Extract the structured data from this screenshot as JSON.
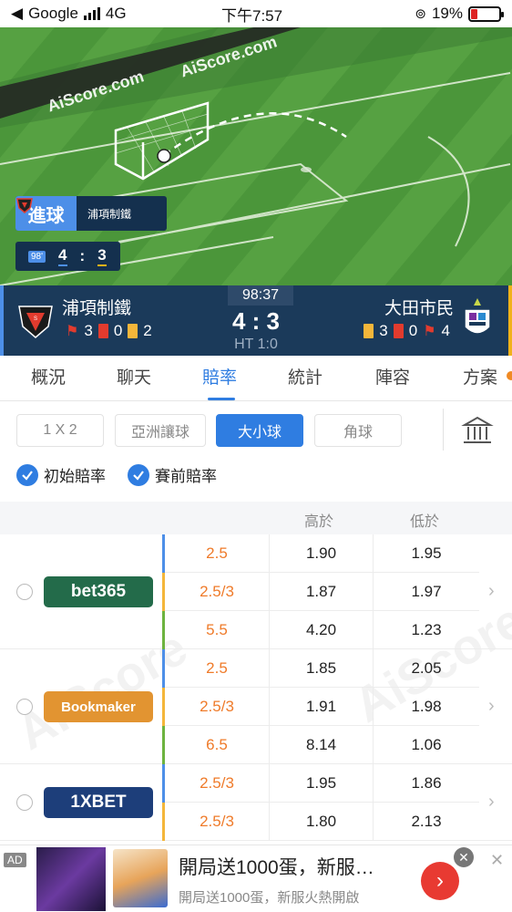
{
  "status_bar": {
    "back_app": "Google",
    "network": "4G",
    "time": "下午7:57",
    "battery": "19%"
  },
  "field": {
    "watermark": "AiScore.com",
    "goal_card": {
      "tag": "進球",
      "team": "浦項制鐵"
    },
    "mini_score": {
      "minute": "98'",
      "home": "4",
      "sep": ":",
      "away": "3"
    }
  },
  "match": {
    "timer": "98:37",
    "score": "4 : 3",
    "half_time": "HT 1:0",
    "home": {
      "name": "浦項制鐵",
      "corners": "3",
      "red": "0",
      "yellow": "2"
    },
    "away": {
      "name": "大田市民",
      "yellow": "3",
      "red": "0",
      "corners": "4"
    }
  },
  "tabs": [
    "概況",
    "聊天",
    "賠率",
    "統計",
    "陣容",
    "方案"
  ],
  "active_tab": "賠率",
  "filters": {
    "buttons": [
      "1 X 2",
      "亞洲讓球",
      "大小球",
      "角球"
    ],
    "active": "大小球",
    "checks": [
      "初始賠率",
      "賽前賠率"
    ]
  },
  "table_head": {
    "over": "高於",
    "under": "低於"
  },
  "bookmakers": [
    {
      "name": "bet365",
      "color": "#236b4a",
      "rows": [
        {
          "line": "2.5",
          "over": "1.90",
          "under": "1.95",
          "bar": "#4d8fe8"
        },
        {
          "line": "2.5/3",
          "over": "1.87",
          "under": "1.97",
          "bar": "#f4b63a"
        },
        {
          "line": "5.5",
          "over": "4.20",
          "under": "1.23",
          "bar": "#6db33f"
        }
      ]
    },
    {
      "name": "Bookmaker",
      "color": "#e29431",
      "rows": [
        {
          "line": "2.5",
          "over": "1.85",
          "under": "2.05",
          "bar": "#4d8fe8"
        },
        {
          "line": "2.5/3",
          "over": "1.91",
          "under": "1.98",
          "bar": "#f4b63a"
        },
        {
          "line": "6.5",
          "over": "8.14",
          "under": "1.06",
          "bar": "#6db33f"
        }
      ]
    },
    {
      "name": "1XBET",
      "color": "#1d3e7a",
      "rows": [
        {
          "line": "2.5/3",
          "over": "1.95",
          "under": "1.86",
          "bar": "#4d8fe8"
        },
        {
          "line": "2.5/3",
          "over": "1.80",
          "under": "2.13",
          "bar": "#f4b63a"
        }
      ]
    }
  ],
  "ad": {
    "label": "AD",
    "title": "開局送1000蛋，新服…",
    "subtitle": "開局送1000蛋，新服火熱開啟"
  }
}
